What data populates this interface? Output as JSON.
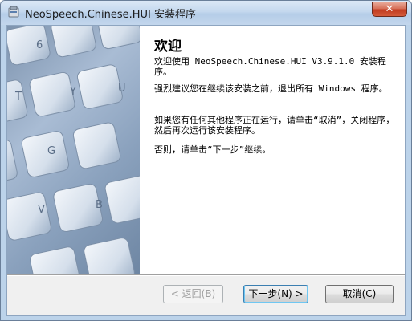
{
  "window": {
    "title": "NeoSpeech.Chinese.HUI 安装程序",
    "close_glyph": "✕"
  },
  "content": {
    "heading": "欢迎",
    "para1": "欢迎使用 NeoSpeech.Chinese.HUI V3.9.1.0 安装程序。",
    "para2": "强烈建议您在继续该安装之前，退出所有 Windows 程序。",
    "para3": "如果您有任何其他程序正在运行，请单击“取消”，关闭程序，然后再次运行该安装程序。",
    "para4": "否则，请单击“下一步”继续。"
  },
  "image_keys": [
    "6",
    "T",
    "Y",
    "U",
    "G",
    "V",
    "B"
  ],
  "buttons": {
    "back": "< 返回(B)",
    "next": "下一步(N) >",
    "cancel": "取消(C)"
  }
}
